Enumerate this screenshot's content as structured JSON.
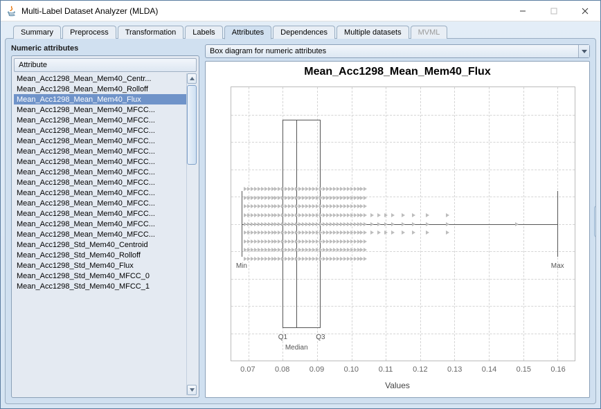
{
  "window": {
    "title": "Multi-Label Dataset Analyzer (MLDA)"
  },
  "tabs": [
    {
      "label": "Summary",
      "active": false,
      "disabled": false
    },
    {
      "label": "Preprocess",
      "active": false,
      "disabled": false
    },
    {
      "label": "Transformation",
      "active": false,
      "disabled": false
    },
    {
      "label": "Labels",
      "active": false,
      "disabled": false
    },
    {
      "label": "Attributes",
      "active": true,
      "disabled": false
    },
    {
      "label": "Dependences",
      "active": false,
      "disabled": false
    },
    {
      "label": "Multiple datasets",
      "active": false,
      "disabled": false
    },
    {
      "label": "MVML",
      "active": false,
      "disabled": true
    }
  ],
  "left": {
    "section_title": "Numeric attributes",
    "column_header": "Attribute",
    "selected_index": 2,
    "items": [
      "Mean_Acc1298_Mean_Mem40_Centr...",
      "Mean_Acc1298_Mean_Mem40_Rolloff",
      "Mean_Acc1298_Mean_Mem40_Flux",
      "Mean_Acc1298_Mean_Mem40_MFCC...",
      "Mean_Acc1298_Mean_Mem40_MFCC...",
      "Mean_Acc1298_Mean_Mem40_MFCC...",
      "Mean_Acc1298_Mean_Mem40_MFCC...",
      "Mean_Acc1298_Mean_Mem40_MFCC...",
      "Mean_Acc1298_Mean_Mem40_MFCC...",
      "Mean_Acc1298_Mean_Mem40_MFCC...",
      "Mean_Acc1298_Mean_Mem40_MFCC...",
      "Mean_Acc1298_Mean_Mem40_MFCC...",
      "Mean_Acc1298_Mean_Mem40_MFCC...",
      "Mean_Acc1298_Mean_Mem40_MFCC...",
      "Mean_Acc1298_Mean_Mem40_MFCC...",
      "Mean_Acc1298_Mean_Mem40_MFCC...",
      "Mean_Acc1298_Std_Mem40_Centroid",
      "Mean_Acc1298_Std_Mem40_Rolloff",
      "Mean_Acc1298_Std_Mem40_Flux",
      "Mean_Acc1298_Std_Mem40_MFCC_0",
      "Mean_Acc1298_Std_Mem40_MFCC_1"
    ]
  },
  "combo": {
    "selected": "Box diagram for numeric attributes"
  },
  "chart_data": {
    "type": "box",
    "title": "Mean_Acc1298_Mean_Mem40_Flux",
    "xlabel": "Values",
    "xlim": [
      0.065,
      0.165
    ],
    "xticks": [
      0.07,
      0.08,
      0.09,
      0.1,
      0.11,
      0.12,
      0.13,
      0.14,
      0.15,
      0.16
    ],
    "box": {
      "min": 0.068,
      "q1": 0.08,
      "median": 0.084,
      "q3": 0.091,
      "max": 0.16
    },
    "annotations": {
      "min": "Min",
      "max": "Max",
      "q1": "Q1",
      "q3": "Q3",
      "median": "Median"
    },
    "jitter_rows": 9,
    "jitter_points": [
      0.069,
      0.07,
      0.071,
      0.072,
      0.073,
      0.074,
      0.075,
      0.076,
      0.077,
      0.078,
      0.079,
      0.08,
      0.081,
      0.082,
      0.083,
      0.084,
      0.085,
      0.086,
      0.087,
      0.088,
      0.089,
      0.09,
      0.091,
      0.092,
      0.093,
      0.094,
      0.095,
      0.096,
      0.097,
      0.098,
      0.099,
      0.1,
      0.101,
      0.102,
      0.103,
      0.104,
      0.106,
      0.108,
      0.11,
      0.112,
      0.115,
      0.118,
      0.122,
      0.128,
      0.148
    ]
  }
}
